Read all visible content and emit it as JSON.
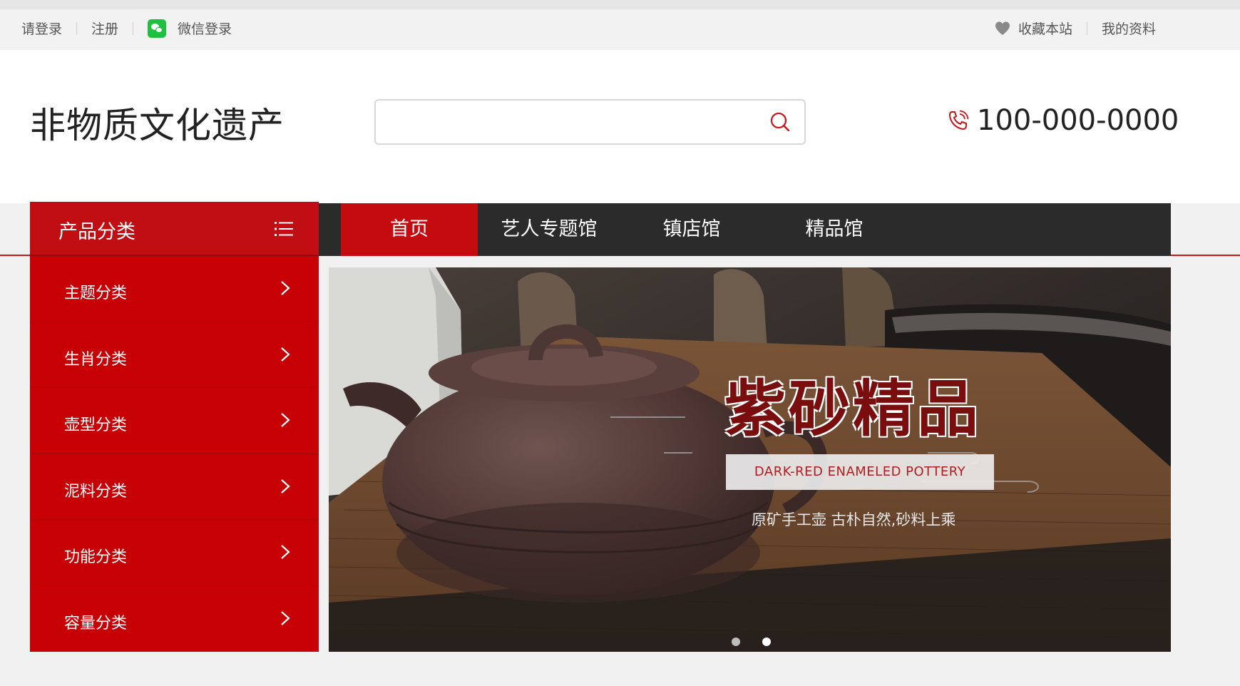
{
  "topbar": {
    "login": "请登录",
    "register": "注册",
    "wechat_login": "微信登录",
    "favorite": "收藏本站",
    "my_profile": "我的资料"
  },
  "header": {
    "logo_text": "非物质文化遗产",
    "search_placeholder": "",
    "phone": "100-000-0000"
  },
  "category": {
    "title": "产品分类",
    "items": [
      {
        "label": "主题分类"
      },
      {
        "label": "生肖分类"
      },
      {
        "label": "壶型分类"
      },
      {
        "label": "泥料分类"
      },
      {
        "label": "功能分类"
      },
      {
        "label": "容量分类"
      }
    ]
  },
  "nav": {
    "tabs": [
      {
        "label": "首页",
        "active": true
      },
      {
        "label": "艺人专题馆",
        "active": false
      },
      {
        "label": "镇店馆",
        "active": false
      },
      {
        "label": "精品馆",
        "active": false
      }
    ]
  },
  "banner": {
    "title": "紫砂精品",
    "subtitle_en": "DARK-RED ENAMELED POTTERY",
    "tagline": "原矿手工壶 古朴自然,砂料上乘",
    "slide_count": 2,
    "active_slide": 2
  },
  "colors": {
    "brand_red": "#c60005",
    "nav_dark": "#2b2b2b",
    "wechat_green": "#1fbf3f"
  },
  "icons": [
    "wechat-icon",
    "heart-icon",
    "search-icon",
    "phone-icon",
    "menu-list-icon",
    "chevron-right-icon"
  ]
}
